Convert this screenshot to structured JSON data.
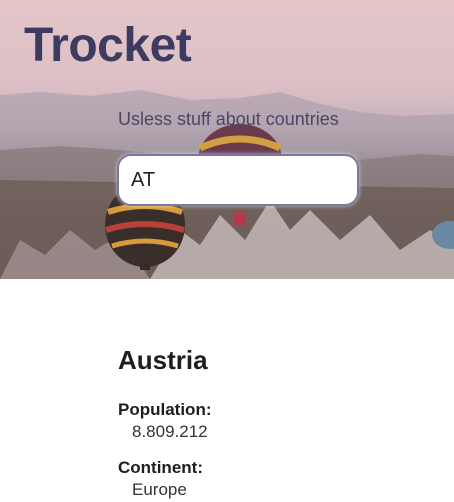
{
  "header": {
    "brand": "Trocket",
    "tagline": "Usless stuff about countries"
  },
  "search": {
    "value": "AT"
  },
  "country": {
    "name": "Austria",
    "facts": [
      {
        "label": "Population:",
        "value": "8.809.212"
      },
      {
        "label": "Continent:",
        "value": "Europe"
      }
    ]
  },
  "colors": {
    "brand_text": "#3e3b62",
    "search_border": "#7a78a6"
  },
  "hero_image": "hot-air-balloons-over-landscape"
}
